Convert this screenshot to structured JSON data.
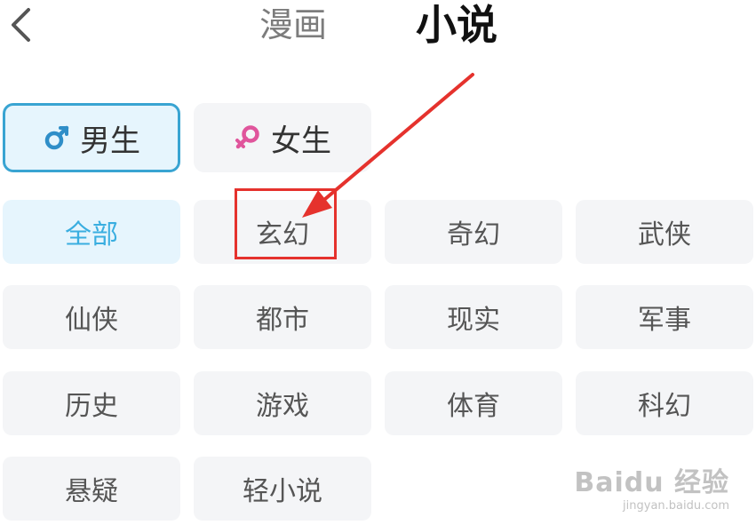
{
  "header": {
    "back_icon": "chevron-left-icon",
    "tabs": [
      "漫画",
      "小说"
    ],
    "active_tab": "小说"
  },
  "gender": {
    "items": [
      {
        "label": "男生",
        "icon": "male-symbol-icon",
        "icon_color": "#2f8ec8",
        "selected": true
      },
      {
        "label": "女生",
        "icon": "female-symbol-icon",
        "icon_color": "#e0559c",
        "selected": false
      }
    ]
  },
  "categories": [
    "全部",
    "玄幻",
    "奇幻",
    "武侠",
    "仙侠",
    "都市",
    "现实",
    "军事",
    "历史",
    "游戏",
    "体育",
    "科幻",
    "悬疑",
    "轻小说"
  ],
  "selected_category": "全部",
  "annotation": {
    "highlighted_category": "玄幻",
    "color": "#e5322d"
  },
  "watermark": {
    "main": "Baidu 经验",
    "sub": "jingyan.baidu.com"
  },
  "colors": {
    "accent": "#3aaee0",
    "chip_bg": "#f4f5f7",
    "selected_bg": "#e6f5fd"
  }
}
